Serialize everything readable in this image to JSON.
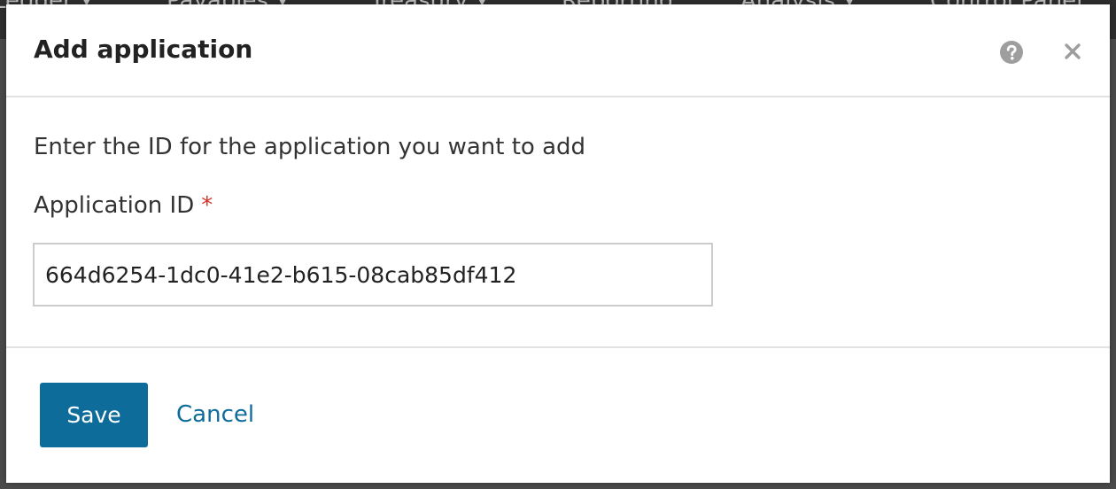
{
  "background_nav": {
    "items": [
      {
        "label": "Ledger"
      },
      {
        "label": "Payables"
      },
      {
        "label": "Treasury"
      },
      {
        "label": "Reporting"
      },
      {
        "label": "Analysis"
      },
      {
        "label": "Control Panel"
      }
    ]
  },
  "dialog": {
    "title": "Add application",
    "help_icon": "help-circle-icon",
    "close_icon": "close-icon",
    "instructions": "Enter the ID for the application you want to add",
    "field_label": "Application ID",
    "required_marker": "*",
    "application_id_value": "664d6254-1dc0-41e2-b615-08cab85df412",
    "save_label": "Save",
    "cancel_label": "Cancel"
  },
  "colors": {
    "primary": "#0e6c9a",
    "required": "#d0342c",
    "icon": "#9e9e9e"
  }
}
